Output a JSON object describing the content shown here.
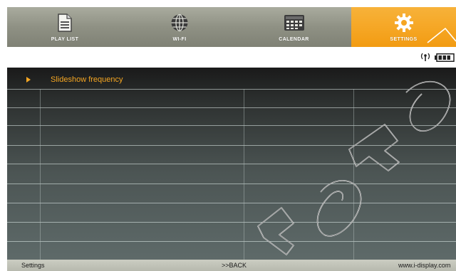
{
  "tabs": [
    {
      "label": "PLAY LIST",
      "icon": "playlist-icon",
      "active": false
    },
    {
      "label": "WI-FI",
      "icon": "globe-icon",
      "active": false
    },
    {
      "label": "CALENDAR",
      "icon": "calendar-icon",
      "active": false
    },
    {
      "label": "SETTINGS",
      "icon": "gear-icon",
      "active": true
    }
  ],
  "status": {
    "signal_icon": "antenna-icon",
    "battery_icon": "battery-icon"
  },
  "panel": {
    "selected_item": "Slideshow frequency"
  },
  "footer": {
    "left": "Settings",
    "center": ">>BACK",
    "right": "www.i-display.com"
  },
  "colors": {
    "accent": "#f5a623",
    "tabbar": "#8f9184",
    "footer": "#bfc1b6"
  }
}
